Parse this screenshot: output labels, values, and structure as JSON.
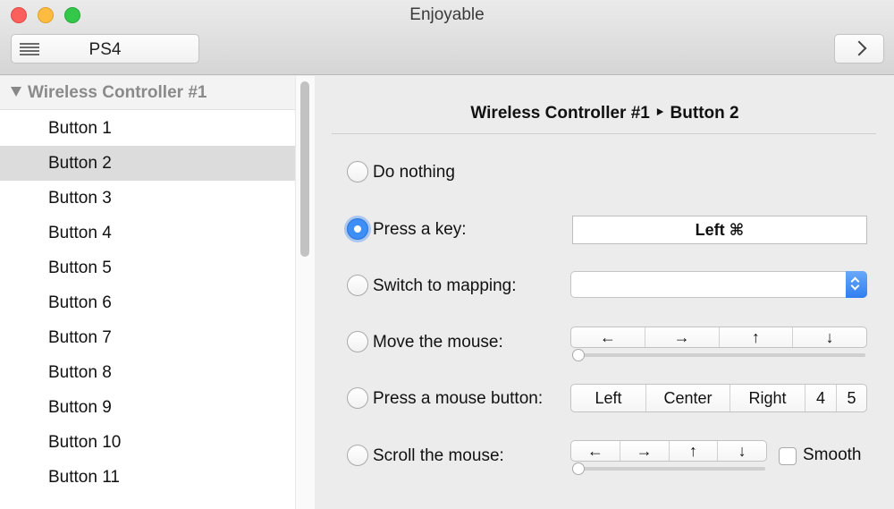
{
  "window": {
    "title": "Enjoyable"
  },
  "toolbar": {
    "mapping_name": "PS4",
    "next_icon": "chevron-right-icon",
    "list_icon": "list-icon"
  },
  "sidebar": {
    "group_label": "Wireless Controller #1",
    "items": [
      {
        "label": "Button 1",
        "selected": false
      },
      {
        "label": "Button 2",
        "selected": true
      },
      {
        "label": "Button 3",
        "selected": false
      },
      {
        "label": "Button 4",
        "selected": false
      },
      {
        "label": "Button 5",
        "selected": false
      },
      {
        "label": "Button 6",
        "selected": false
      },
      {
        "label": "Button 7",
        "selected": false
      },
      {
        "label": "Button 8",
        "selected": false
      },
      {
        "label": "Button 9",
        "selected": false
      },
      {
        "label": "Button 10",
        "selected": false
      },
      {
        "label": "Button 11",
        "selected": false
      }
    ]
  },
  "detail": {
    "title": "Wireless Controller #1 ‣ Button 2",
    "options": {
      "do_nothing": "Do nothing",
      "press_key": "Press a key:",
      "switch_mapping": "Switch to mapping:",
      "move_mouse": "Move the mouse:",
      "press_mouse_button": "Press a mouse button:",
      "scroll_mouse": "Scroll the mouse:"
    },
    "selected_option": "press_key",
    "key_value": "Left ⌘",
    "mapping_value": "",
    "move_directions": [
      "←",
      "→",
      "↑",
      "↓"
    ],
    "mouse_buttons": [
      "Left",
      "Center",
      "Right",
      "4",
      "5"
    ],
    "scroll_directions": [
      "←",
      "→",
      "↑",
      "↓"
    ],
    "move_speed": 0,
    "scroll_speed": 0,
    "smooth_label": "Smooth",
    "smooth_checked": false
  }
}
